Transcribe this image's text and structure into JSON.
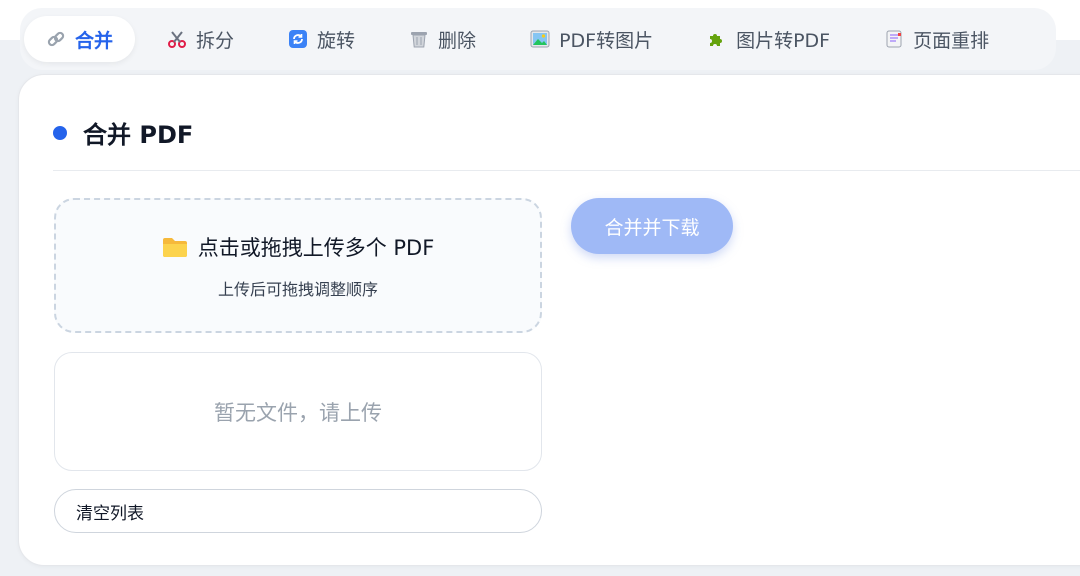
{
  "tabs": [
    {
      "label": "合并",
      "icon": "link-icon",
      "active": true
    },
    {
      "label": "拆分",
      "icon": "scissors-icon",
      "active": false
    },
    {
      "label": "旋转",
      "icon": "rotate-icon",
      "active": false
    },
    {
      "label": "删除",
      "icon": "trash-icon",
      "active": false
    },
    {
      "label": "PDF转图片",
      "icon": "picture-icon",
      "active": false
    },
    {
      "label": "图片转PDF",
      "icon": "puzzle-icon",
      "active": false
    },
    {
      "label": "页面重排",
      "icon": "page-icon",
      "active": false
    }
  ],
  "card": {
    "title": "合并 PDF",
    "upload": {
      "title": "点击或拖拽上传多个 PDF",
      "hint": "上传后可拖拽调整顺序",
      "icon": "folder-icon"
    },
    "file_list": {
      "empty_text": "暂无文件，请上传"
    },
    "clear_button": "清空列表",
    "merge_button": "合并并下载"
  },
  "colors": {
    "accent": "#2563eb",
    "merge_button": "#9fb9f6",
    "background": "#eef1f5"
  }
}
